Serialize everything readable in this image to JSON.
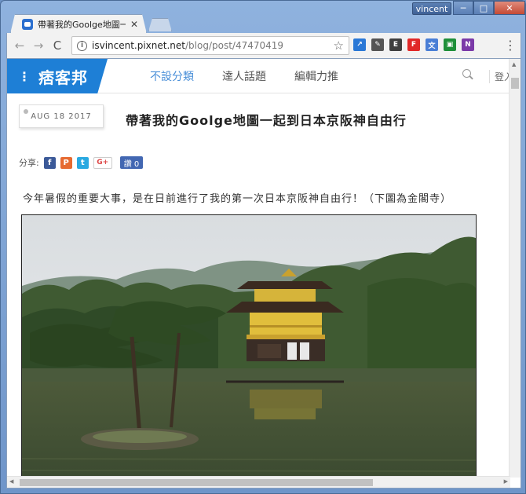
{
  "window": {
    "user": "vincent",
    "controls": {
      "minimize": "─",
      "maximize": "□",
      "close": "✕"
    }
  },
  "tab": {
    "title": "帶著我的Goolge地圖一起",
    "close": "✕"
  },
  "toolbar": {
    "back": "←",
    "forward": "→",
    "reload": "C",
    "url_host": "isvincent.pixnet.net",
    "url_path": "/blog/post/47470419",
    "info_icon": "i",
    "star": "☆",
    "menu": "⋮"
  },
  "extensions": [
    {
      "icon": "chart-icon",
      "color": "#2a78d6",
      "glyph": "↗"
    },
    {
      "icon": "brush-icon",
      "color": "#555555",
      "glyph": "✎"
    },
    {
      "icon": "evernote-icon",
      "color": "#3f3f3f",
      "glyph": "E"
    },
    {
      "icon": "flipboard-icon",
      "color": "#e12828",
      "glyph": "F"
    },
    {
      "icon": "translate-icon",
      "color": "#4a7fd6",
      "glyph": "文"
    },
    {
      "icon": "classroom-icon",
      "color": "#1f8f3a",
      "glyph": "▣"
    },
    {
      "icon": "onenote-icon",
      "color": "#7b3aa8",
      "glyph": "N"
    }
  ],
  "site": {
    "logo": "痞客邦",
    "menu_glyph": "⋮",
    "nav": [
      "不設分類",
      "達人話題",
      "編輯力推"
    ],
    "login": "登入"
  },
  "post": {
    "date": "AUG 18 2017",
    "title": "帶著我的Goolge地圖一起到日本京阪神自由行",
    "share_label": "分享:",
    "like_label": "讚 0",
    "text": "今年暑假的重要大事，是在日前進行了我的第一次日本京阪神自由行！（下圖為金閣寺）"
  },
  "share_buttons": [
    {
      "icon": "facebook-icon",
      "color": "#3b5998",
      "glyph": "f"
    },
    {
      "icon": "plurk-icon",
      "color": "#e66a31",
      "glyph": "P"
    },
    {
      "icon": "twitter-icon",
      "color": "#29a9e1",
      "glyph": "t"
    }
  ],
  "gplus": "G+"
}
